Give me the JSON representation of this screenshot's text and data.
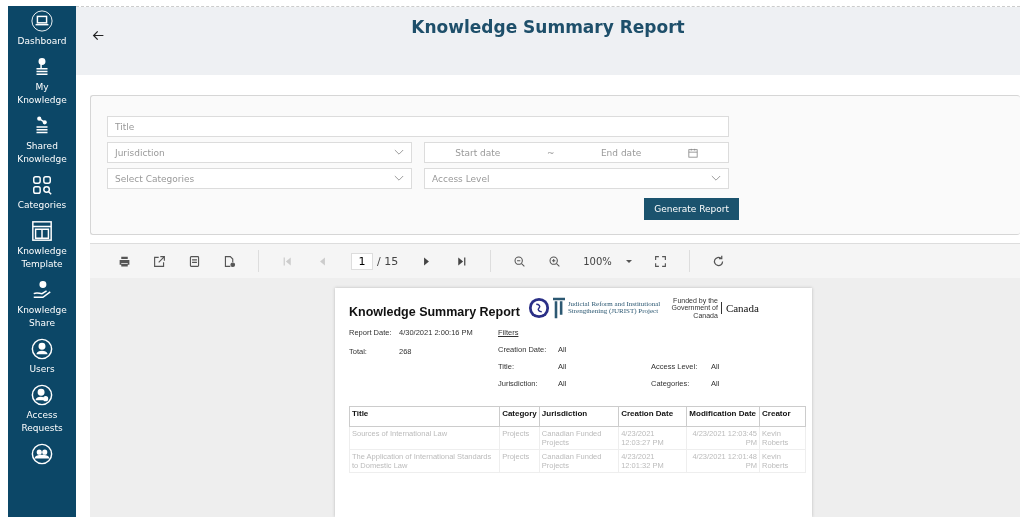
{
  "sidebar": {
    "items": [
      {
        "label": "Dashboard"
      },
      {
        "label": "My Knowledge"
      },
      {
        "label": "Shared Knowledge"
      },
      {
        "label": "Categories"
      },
      {
        "label": "Knowledge Template"
      },
      {
        "label": "Knowledge Share"
      },
      {
        "label": "Users"
      },
      {
        "label": "Access Requests"
      }
    ]
  },
  "header": {
    "title": "Knowledge Summary Report"
  },
  "filters": {
    "title": {
      "placeholder": "Title"
    },
    "jurisdiction": {
      "placeholder": "Jurisdiction"
    },
    "start_date": {
      "placeholder": "Start date"
    },
    "separator": "~",
    "end_date": {
      "placeholder": "End date"
    },
    "categories": {
      "placeholder": "Select Categories"
    },
    "access_level": {
      "placeholder": "Access Level"
    },
    "button": "Generate Report"
  },
  "toolbar": {
    "first_disabled": true,
    "prev_disabled": true,
    "next_disabled": false,
    "last_disabled": false,
    "page": "1",
    "page_total": "/ 15",
    "zoom": "100%"
  },
  "report": {
    "title": "Knowledge Summary Report",
    "report_date_label": "Report Date:",
    "report_date": "4/30/2021 2:00:16 PM",
    "total_label": "Total:",
    "total": "268",
    "filters_heading": "Filters",
    "filter_rows": [
      [
        {
          "label": "Creation Date:",
          "value": "All"
        }
      ],
      [
        {
          "label": "Title:",
          "value": "All"
        },
        {
          "label": "Access Level:",
          "value": "All"
        }
      ],
      [
        {
          "label": "Jurisdiction:",
          "value": "All"
        },
        {
          "label": "Categories:",
          "value": "All"
        }
      ]
    ],
    "logo_text": "Judicial Reform and Institutional Strengthening (JURIST) Project",
    "funded_text": "Funded by the Government of Canada",
    "canada": "Canada",
    "columns": [
      "Title",
      "Category",
      "Jurisdiction",
      "Creation Date",
      "Modification Date",
      "Creator"
    ],
    "rows": [
      [
        "Sources of International Law",
        "Projects",
        "Canadian Funded Projects",
        "4/23/2021 12:03:27 PM",
        "4/23/2021 12:03:45 PM",
        "Kevin Roberts"
      ],
      [
        "The Application of International Standards to Domestic Law",
        "Projects",
        "Canadian Funded Projects",
        "4/23/2021 12:01:32 PM",
        "4/23/2021 12:01:48 PM",
        "Kevin Roberts"
      ]
    ]
  }
}
